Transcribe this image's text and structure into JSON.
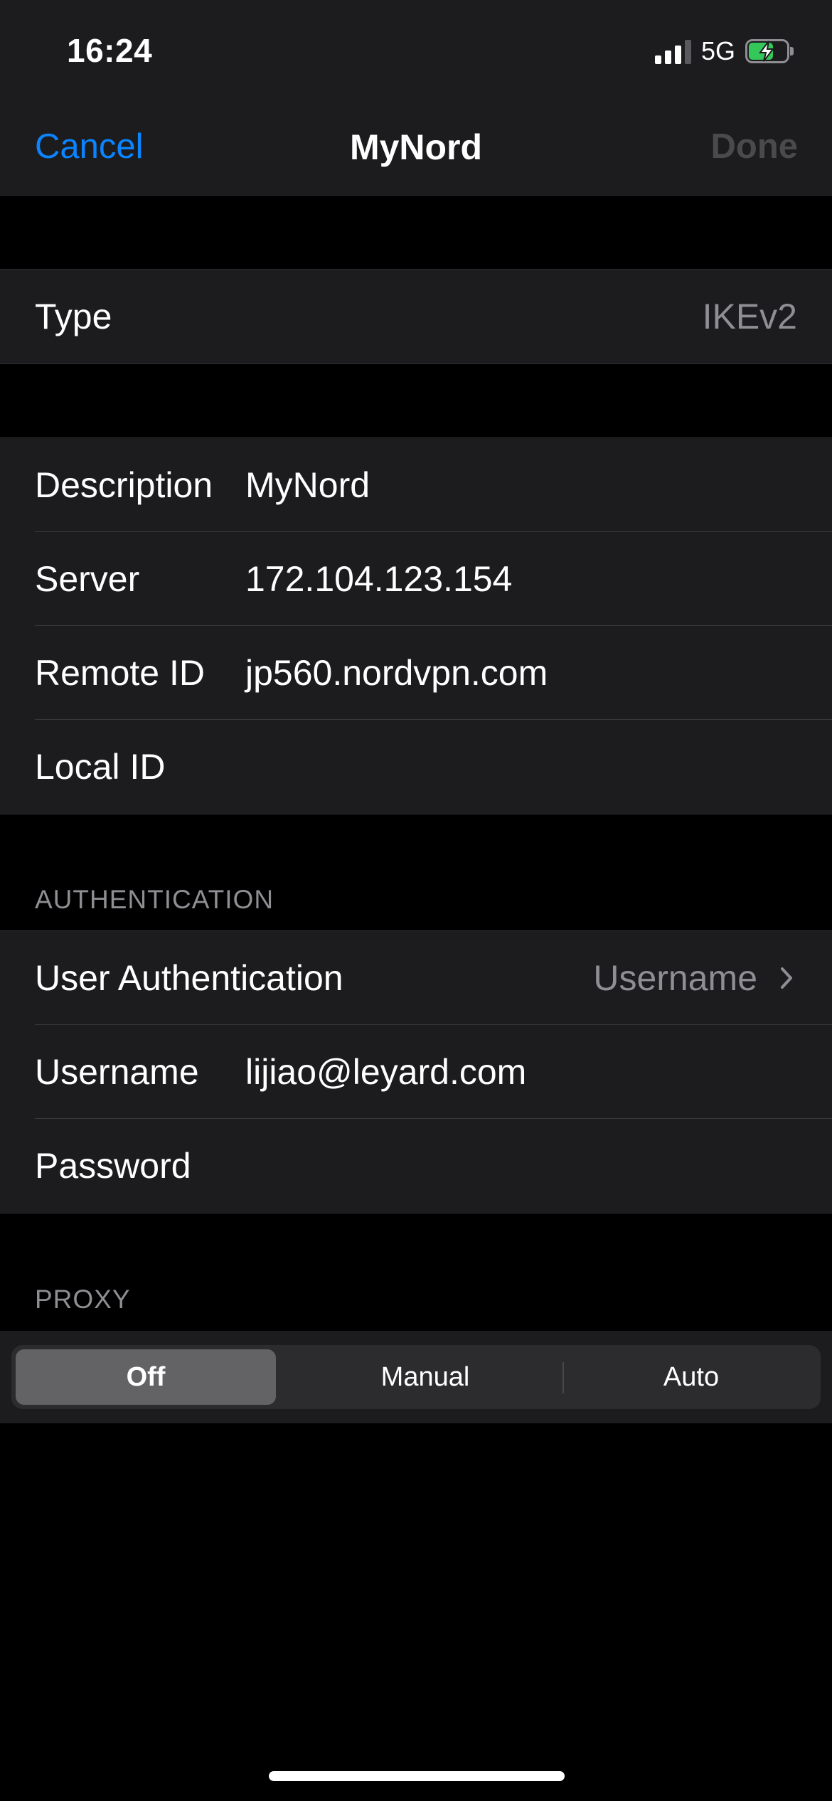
{
  "status_bar": {
    "time": "16:24",
    "network": "5G",
    "signal_bars_active": 3,
    "signal_bars_total": 4,
    "battery_charging": true
  },
  "nav": {
    "cancel_label": "Cancel",
    "title": "MyNord",
    "done_label": "Done"
  },
  "type_row": {
    "label": "Type",
    "value": "IKEv2"
  },
  "connection": {
    "description": {
      "label": "Description",
      "value": "MyNord"
    },
    "server": {
      "label": "Server",
      "value": "172.104.123.154"
    },
    "remote_id": {
      "label": "Remote ID",
      "value": "jp560.nordvpn.com"
    },
    "local_id": {
      "label": "Local ID",
      "value": ""
    }
  },
  "authentication": {
    "header": "AUTHENTICATION",
    "user_auth": {
      "label": "User Authentication",
      "value": "Username"
    },
    "username": {
      "label": "Username",
      "value": "lijiao@leyard.com"
    },
    "password": {
      "label": "Password",
      "value": ""
    }
  },
  "proxy": {
    "header": "PROXY",
    "options": [
      "Off",
      "Manual",
      "Auto"
    ],
    "selected": "Off"
  },
  "colors": {
    "accent": "#0a84ff",
    "battery": "#34c759",
    "background": "#000000",
    "cell": "#1c1c1e",
    "secondary_text": "#8e8e93"
  }
}
